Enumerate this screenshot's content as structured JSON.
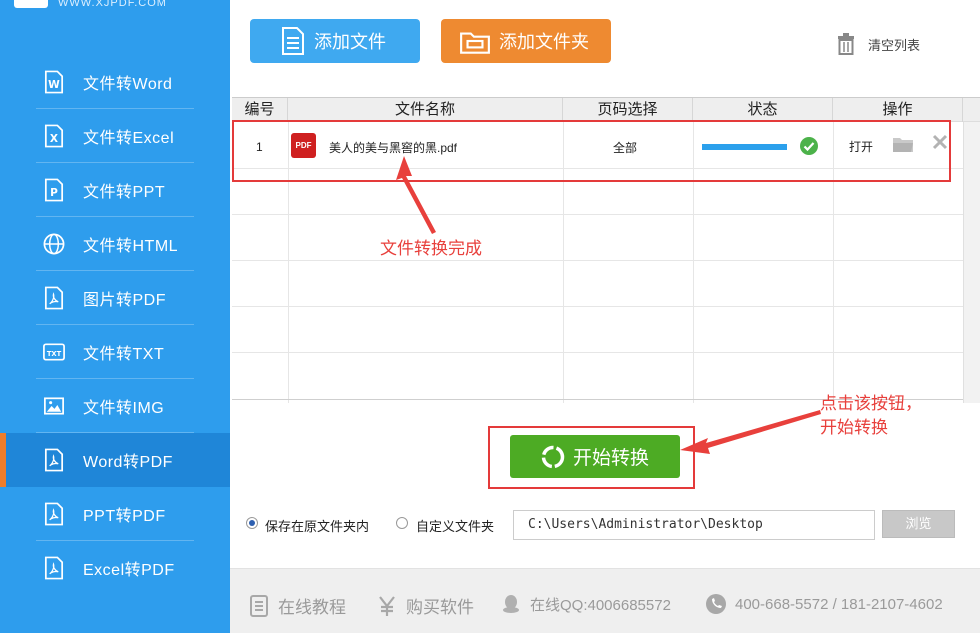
{
  "logo": {
    "text": "WWW.XJPDF.COM"
  },
  "sidebar": {
    "items": [
      {
        "label": "文件转Word",
        "icon": "word-doc-icon"
      },
      {
        "label": "文件转Excel",
        "icon": "excel-doc-icon"
      },
      {
        "label": "文件转PPT",
        "icon": "ppt-doc-icon"
      },
      {
        "label": "文件转HTML",
        "icon": "globe-icon"
      },
      {
        "label": "图片转PDF",
        "icon": "pdf-doc-icon"
      },
      {
        "label": "文件转TXT",
        "icon": "txt-doc-icon"
      },
      {
        "label": "文件转IMG",
        "icon": "image-icon"
      },
      {
        "label": "Word转PDF",
        "icon": "pdf-doc-icon",
        "active": true
      },
      {
        "label": "PPT转PDF",
        "icon": "pdf-doc-icon"
      },
      {
        "label": "Excel转PDF",
        "icon": "pdf-doc-icon"
      }
    ]
  },
  "toolbar": {
    "add_file_label": "添加文件",
    "add_folder_label": "添加文件夹",
    "clear_list_label": "清空列表"
  },
  "table": {
    "columns": [
      "编号",
      "文件名称",
      "页码选择",
      "状态",
      "操作"
    ],
    "rows": [
      {
        "index": "1",
        "file_badge": "PDF",
        "file_name": "美人的美与黑窖的黑.pdf",
        "pages": "全部",
        "progress": 1.0,
        "status_icon": "check-circle-icon",
        "open_label": "打开"
      }
    ]
  },
  "annotations": {
    "file_done": "文件转换完成",
    "click_hint_line1": "点击该按钮，",
    "click_hint_line2": "开始转换"
  },
  "convert": {
    "label": "开始转换"
  },
  "output": {
    "option_original": "保存在原文件夹内",
    "option_custom": "自定义文件夹",
    "selected": "original",
    "path": "C:\\Users\\Administrator\\Desktop",
    "browse_label": "浏览"
  },
  "footer": {
    "tutorial_label": "在线教程",
    "buy_label": "购买软件",
    "qq_label": "在线QQ:4006685572",
    "phone_label": "400-668-5572 / 181-2107-4602"
  },
  "colors": {
    "sidebar_bg": "#2e9ded",
    "sidebar_active": "#1f86d8",
    "accent_orange": "#ee8a31",
    "add_file_blue": "#3fa9f0",
    "convert_green": "#4dab24",
    "annotation_red": "#e8403c"
  }
}
